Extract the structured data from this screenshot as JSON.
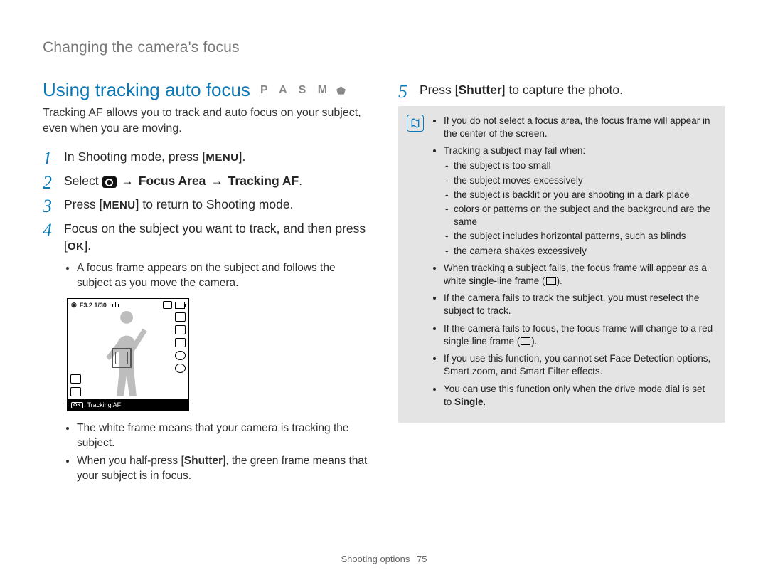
{
  "header": {
    "title": "Changing the camera's focus"
  },
  "section": {
    "heading": "Using tracking auto focus",
    "modes": "P A S M",
    "intro": "Tracking AF allows you to track and auto focus on your subject, even when you are moving."
  },
  "steps": {
    "s1": {
      "num": "1",
      "pre": "In Shooting mode, press [",
      "btn": "MENU",
      "post": "]."
    },
    "s2": {
      "num": "2",
      "pre": "Select ",
      "arrow": "→",
      "fa": "Focus Area",
      "tr": "Tracking AF",
      "post": "."
    },
    "s3": {
      "num": "3",
      "pre": "Press [",
      "btn": "MENU",
      "post": "] to return to Shooting mode."
    },
    "s4": {
      "num": "4",
      "text_a": "Focus on the subject you want to track, and then press ",
      "btn": "OK",
      "text_b": "[",
      "text_c": "]."
    },
    "s4_sub": {
      "b1": "A focus frame appears on the subject and follows the subject as you move the camera.",
      "b2": "The white frame means that your camera is tracking the subject.",
      "b3_a": "When you half-press [",
      "b3_bold": "Shutter",
      "b3_b": "], the green frame means that your subject is in focus."
    },
    "s5": {
      "num": "5",
      "pre": "Press [",
      "bold": "Shutter",
      "post": "] to capture the photo."
    }
  },
  "lcd": {
    "top": "F3.2 1/30",
    "bottom_label": "Tracking AF",
    "ok": "OK"
  },
  "notes": {
    "n1": "If you do not select a focus area, the focus frame will appear in the center of the screen.",
    "n2": "Tracking a subject may fail when:",
    "n2_sub": {
      "a": "the subject is too small",
      "b": "the subject moves excessively",
      "c": "the subject is backlit or you are shooting in a dark place",
      "d": "colors or patterns on the subject and the background are the same",
      "e": "the subject includes horizontal patterns, such as blinds",
      "f": "the camera shakes excessively"
    },
    "n3_a": "When tracking a subject fails, the focus frame will appear as a white single-line frame (",
    "n3_b": ").",
    "n4": "If the camera fails to track the subject, you must reselect the subject to track.",
    "n5_a": "If the camera fails to focus, the focus frame will change to a red single-line frame (",
    "n5_b": ").",
    "n6": "If you use this function, you cannot set Face Detection options, Smart zoom, and Smart Filter effects.",
    "n7_a": "You can use this function only when the drive mode dial is set to ",
    "n7_bold": "Single",
    "n7_b": "."
  },
  "footer": {
    "section": "Shooting options",
    "page": "75"
  }
}
